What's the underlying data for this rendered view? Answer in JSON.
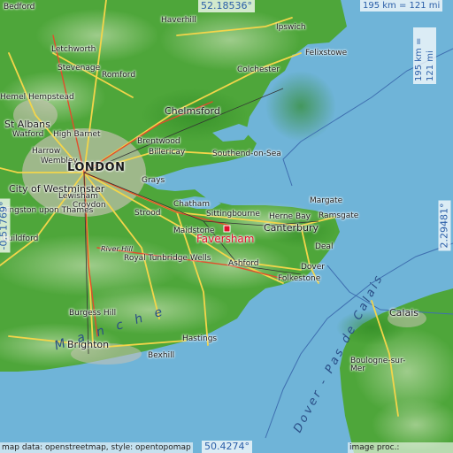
{
  "map": {
    "highlight_city": "Faversham",
    "coords": {
      "north": "52.18536°",
      "south": "50.4274°",
      "west": "-0.51769°",
      "east": "2.29481°"
    },
    "scale": {
      "horizontal": "195 km = 121 mi",
      "vertical": "195 km = 121 mi"
    },
    "credits": {
      "left": "map data: openstreetmap, style: opentopomap",
      "right": "image proc.: elevation.city"
    },
    "sea_labels": {
      "manche": "M a n c h e",
      "dover": "Dover - Pas de Calais"
    },
    "colors": {
      "sea": "#6fb4d8",
      "land_low": "#3c9a2e",
      "land_high": "#9cc98a",
      "road": "#f3d54a",
      "marker": "#e0102a"
    },
    "places": [
      {
        "name": "Bedford",
        "size": "small"
      },
      {
        "name": "Haverhill",
        "size": "small"
      },
      {
        "name": "Ipswich",
        "size": "small"
      },
      {
        "name": "Letchworth",
        "size": "small"
      },
      {
        "name": "Stevenage",
        "size": "small"
      },
      {
        "name": "Felixstowe",
        "size": "small"
      },
      {
        "name": "Colchester",
        "size": "small"
      },
      {
        "name": "Hemel Hempstead",
        "size": "small"
      },
      {
        "name": "Romford",
        "size": "small"
      },
      {
        "name": "Chelmsford",
        "size": "med"
      },
      {
        "name": "St Albans",
        "size": "med"
      },
      {
        "name": "Watford",
        "size": "small"
      },
      {
        "name": "High Barnet",
        "size": "small"
      },
      {
        "name": "Brentwood",
        "size": "small"
      },
      {
        "name": "Billericay",
        "size": "small"
      },
      {
        "name": "Harrow",
        "size": "small"
      },
      {
        "name": "Wembley",
        "size": "small"
      },
      {
        "name": "LONDON",
        "size": "big"
      },
      {
        "name": "Southend-on-Sea",
        "size": "small"
      },
      {
        "name": "City of Westminster",
        "size": "med"
      },
      {
        "name": "Grays",
        "size": "small"
      },
      {
        "name": "Lewisham",
        "size": "small"
      },
      {
        "name": "Croydon",
        "size": "small"
      },
      {
        "name": "Kingston upon Thames",
        "size": "small"
      },
      {
        "name": "Chatham",
        "size": "small"
      },
      {
        "name": "Margate",
        "size": "small"
      },
      {
        "name": "Strood",
        "size": "small"
      },
      {
        "name": "Sittingbourne",
        "size": "small"
      },
      {
        "name": "Herne Bay",
        "size": "small"
      },
      {
        "name": "Ramsgate",
        "size": "small"
      },
      {
        "name": "Maidstone",
        "size": "small"
      },
      {
        "name": "Canterbury",
        "size": "med"
      },
      {
        "name": "Guildford",
        "size": "small"
      },
      {
        "name": "Deal",
        "size": "small"
      },
      {
        "name": "River Hill",
        "size": "ital"
      },
      {
        "name": "Royal Tunbridge Wells",
        "size": "small"
      },
      {
        "name": "Ashford",
        "size": "small"
      },
      {
        "name": "Dover",
        "size": "small"
      },
      {
        "name": "Folkestone",
        "size": "small"
      },
      {
        "name": "Calais",
        "size": "med"
      },
      {
        "name": "Burgess Hill",
        "size": "small"
      },
      {
        "name": "Boulogne-sur-Mer",
        "size": "small"
      },
      {
        "name": "Brighton",
        "size": "med"
      },
      {
        "name": "Hastings",
        "size": "small"
      },
      {
        "name": "Bexhill",
        "size": "small"
      }
    ]
  }
}
